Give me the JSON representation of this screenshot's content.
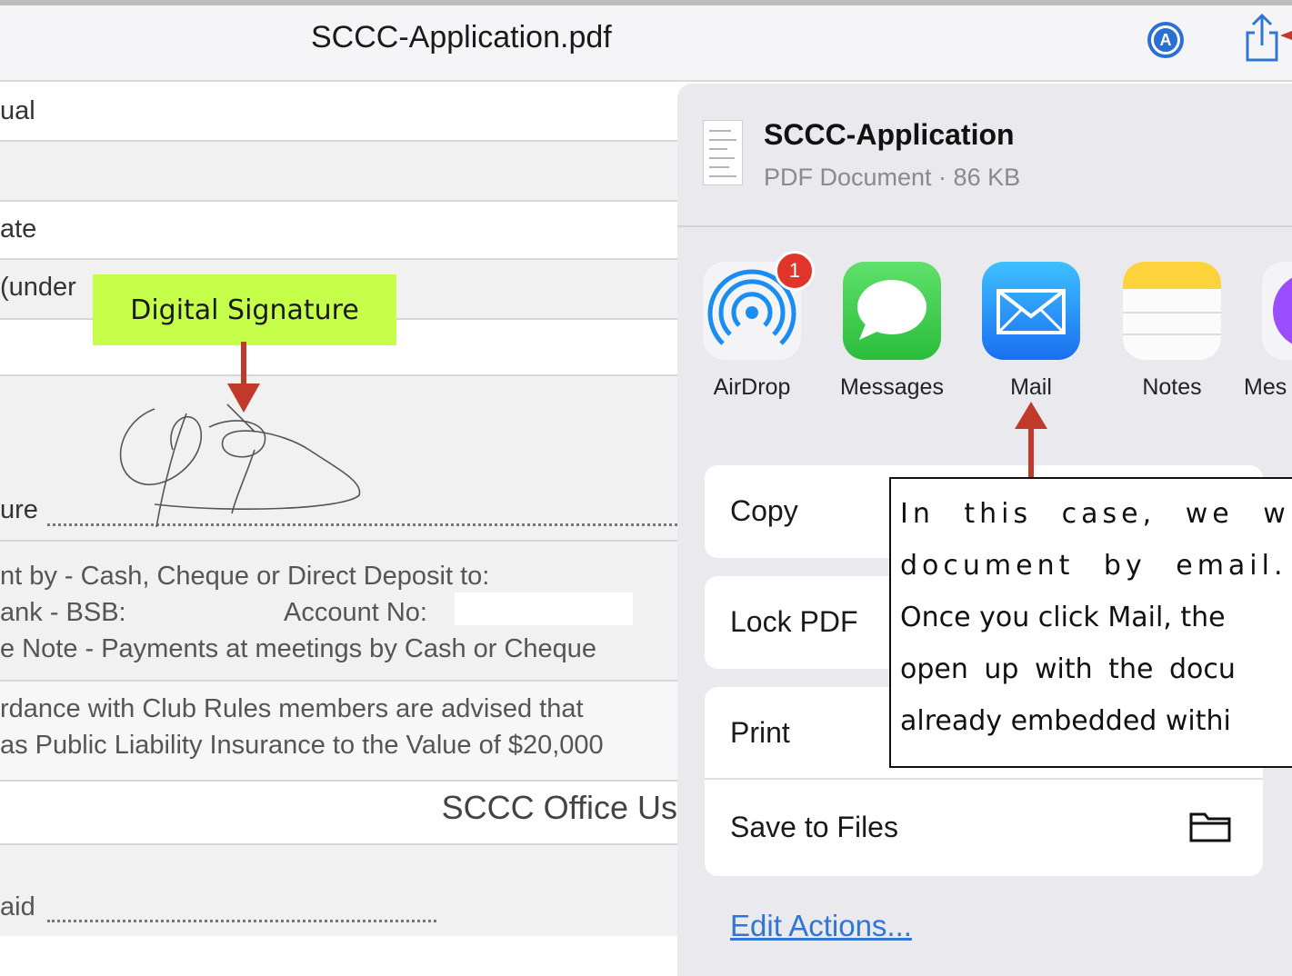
{
  "navbar": {
    "title": "SCCC-Application.pdf",
    "markup_icon_letter": "A"
  },
  "document": {
    "field_1": "ual",
    "field_2": "ate",
    "field_3": "(under",
    "signature_field": "ure",
    "payment_line_1": "nt by - Cash, Cheque or Direct Deposit to:",
    "payment_bank": "ank - BSB:",
    "payment_account": "Account No:",
    "payment_line_3": "e Note - Payments at meetings by Cash or Cheque",
    "rules_line_1": "rdance with Club Rules members are advised that",
    "rules_line_2": "as Public Liability Insurance to the Value of $20,000",
    "office_use": "SCCC Office Us",
    "paid": "aid"
  },
  "annotations": {
    "signature_label": "Digital Signature",
    "callout_lines": [
      "In this case, we wi",
      "document by email. C",
      "Once you click Mail, the",
      "open up with the docu",
      "already embedded withi"
    ]
  },
  "share_sheet": {
    "file_name": "SCCC-Application",
    "file_meta": "PDF Document · 86 KB",
    "airdrop_badge": "1",
    "apps": [
      {
        "label": "AirDrop",
        "icon": "airdrop-icon"
      },
      {
        "label": "Messages",
        "icon": "messages-icon"
      },
      {
        "label": "Mail",
        "icon": "mail-icon"
      },
      {
        "label": "Notes",
        "icon": "notes-icon"
      },
      {
        "label": "Mes",
        "icon": "messenger-icon"
      }
    ],
    "actions": [
      {
        "label": "Copy"
      },
      {
        "label": "Lock PDF"
      },
      {
        "label": "Print"
      },
      {
        "label": "Save to Files",
        "icon": "folder-icon"
      }
    ],
    "edit_actions": "Edit Actions..."
  },
  "colors": {
    "accent_blue": "#2f76d6",
    "annotation_red": "#c0392b",
    "label_green": "#c6ff4a"
  }
}
